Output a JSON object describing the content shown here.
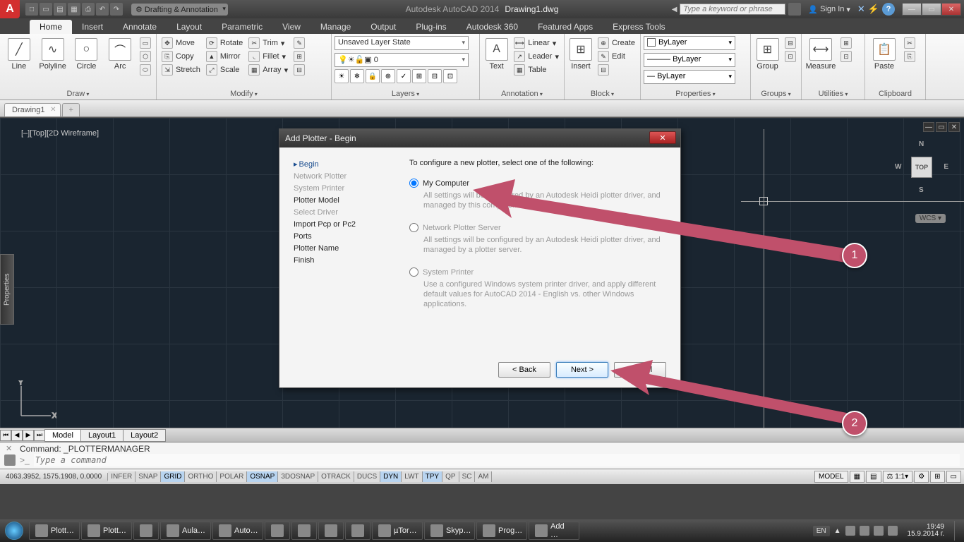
{
  "title": {
    "app": "Autodesk AutoCAD 2014",
    "doc": "Drawing1.dwg"
  },
  "workspace": "Drafting & Annotation",
  "search_placeholder": "Type a keyword or phrase",
  "signin": "Sign In",
  "menutabs": [
    "Home",
    "Insert",
    "Annotate",
    "Layout",
    "Parametric",
    "View",
    "Manage",
    "Output",
    "Plug-ins",
    "Autodesk 360",
    "Featured Apps",
    "Express Tools"
  ],
  "ribbon": {
    "draw": {
      "title": "Draw",
      "items": [
        "Line",
        "Polyline",
        "Circle",
        "Arc"
      ]
    },
    "modify": {
      "title": "Modify",
      "col1": [
        "Move",
        "Copy",
        "Stretch"
      ],
      "col2": [
        "Rotate",
        "Mirror",
        "Scale"
      ],
      "col3": [
        "Trim",
        "Fillet",
        "Array"
      ]
    },
    "layers": {
      "title": "Layers",
      "combo1": "Unsaved Layer State",
      "combo2": "0"
    },
    "annotation": {
      "title": "Annotation",
      "text": "Text",
      "items": [
        "Linear",
        "Leader",
        "Table"
      ]
    },
    "insert": {
      "title": "Insert",
      "btn": "Insert"
    },
    "block": {
      "title": "Block",
      "items": [
        "Create",
        "Edit"
      ]
    },
    "properties": {
      "title": "Properties",
      "bylayer": "ByLayer"
    },
    "groups": {
      "title": "Groups",
      "btn": "Group"
    },
    "utilities": {
      "title": "Utilities",
      "btn": "Measure"
    },
    "clipboard": {
      "title": "Clipboard",
      "btn": "Paste"
    }
  },
  "doctab": "Drawing1",
  "view_label": "[–][Top][2D Wireframe]",
  "viewcube": {
    "top": "TOP",
    "n": "N",
    "s": "S",
    "e": "E",
    "w": "W"
  },
  "wcs": "WCS",
  "ucs": {
    "y": "Y",
    "x": "X"
  },
  "layout_tabs": [
    "Model",
    "Layout1",
    "Layout2"
  ],
  "cmd_history": "Command: _PLOTTERMANAGER",
  "cmd_prompt": ">_",
  "cmd_placeholder": "Type a command",
  "status": {
    "coords": "4063.3952, 1575.1908, 0.0000",
    "toggles": [
      "INFER",
      "SNAP",
      "GRID",
      "ORTHO",
      "POLAR",
      "OSNAP",
      "3DOSNAP",
      "OTRACK",
      "DUCS",
      "DYN",
      "LWT",
      "TPY",
      "QP",
      "SC",
      "AM"
    ],
    "toggles_on": [
      "GRID",
      "OSNAP",
      "DYN",
      "TPY"
    ],
    "model": "MODEL",
    "scale": "1:1"
  },
  "side_tab": "Properties",
  "dialog": {
    "title": "Add Plotter - Begin",
    "nav": [
      "Begin",
      "Network Plotter",
      "System Printer",
      "Plotter Model",
      "Select Driver",
      "Import Pcp or Pc2",
      "Ports",
      "Plotter Name",
      "Finish"
    ],
    "nav_active": 0,
    "nav_available": [
      3,
      5,
      6,
      7,
      8
    ],
    "intro": "To configure a new plotter, select one of the following:",
    "opt1": {
      "label": "My Computer",
      "desc": "All settings will be configured by an Autodesk Heidi plotter driver, and managed by this computer."
    },
    "opt2": {
      "label": "Network Plotter Server",
      "desc": "All settings will be configured by an Autodesk Heidi plotter driver, and managed by a plotter server."
    },
    "opt3": {
      "label": "System Printer",
      "desc": "Use a configured Windows system printer driver, and apply different default values for AutoCAD 2014 - English vs. other Windows applications."
    },
    "buttons": {
      "back": "< Back",
      "next": "Next >",
      "cancel": "Cancel"
    }
  },
  "annotations": {
    "b1": "1",
    "b2": "2"
  },
  "taskbar": {
    "items": [
      "Plott…",
      "Plott…",
      "",
      "Aula…",
      "Auto…",
      "",
      "",
      "",
      "",
      "µTor…",
      "Skyp…",
      "Prog…",
      "Add …"
    ],
    "lang": "EN",
    "time": "19:49",
    "date": "15.9.2014 г."
  }
}
